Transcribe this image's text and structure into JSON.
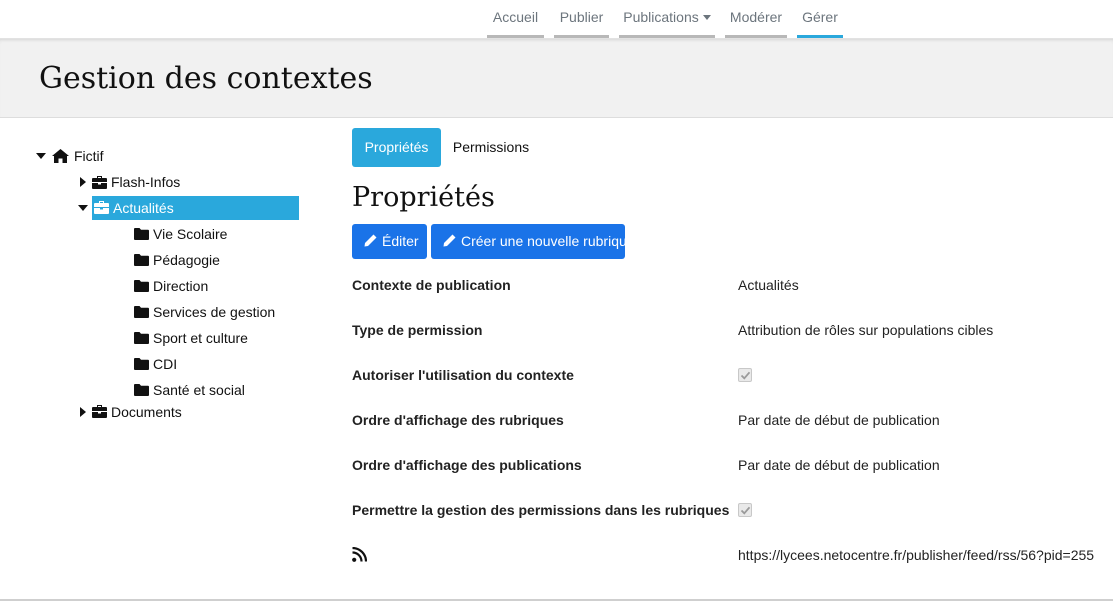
{
  "topnav": {
    "items": [
      {
        "label": "Accueil",
        "active": false
      },
      {
        "label": "Publier",
        "active": false
      },
      {
        "label": "Publications",
        "active": false,
        "dropdown": true
      },
      {
        "label": "Modérer",
        "active": false
      },
      {
        "label": "Gérer",
        "active": true
      }
    ]
  },
  "header": {
    "title": "Gestion des contextes"
  },
  "tree": {
    "root": {
      "label": "Fictif",
      "icon": "home-icon",
      "expanded": true
    },
    "items": [
      {
        "label": "Flash-Infos",
        "icon": "briefcase-icon",
        "expanded": false
      },
      {
        "label": "Actualités",
        "icon": "briefcase-icon",
        "expanded": true,
        "selected": true
      },
      {
        "label": "Vie Scolaire",
        "icon": "folder-icon"
      },
      {
        "label": "Pédagogie",
        "icon": "folder-icon"
      },
      {
        "label": "Direction",
        "icon": "folder-icon"
      },
      {
        "label": "Services de gestion",
        "icon": "folder-icon"
      },
      {
        "label": "Sport et culture",
        "icon": "folder-icon"
      },
      {
        "label": "CDI",
        "icon": "folder-icon"
      },
      {
        "label": "Santé et social",
        "icon": "folder-icon"
      },
      {
        "label": "Documents",
        "icon": "briefcase-icon",
        "expanded": false
      }
    ]
  },
  "tabs": [
    {
      "label": "Propriétés",
      "active": true
    },
    {
      "label": "Permissions",
      "active": false
    }
  ],
  "section": {
    "title": "Propriétés"
  },
  "actions": {
    "edit_label": "Éditer",
    "new_rubric_label": "Créer une nouvelle rubrique"
  },
  "properties": [
    {
      "label": "Contexte de publication",
      "value": "Actualités"
    },
    {
      "label": "Type de permission",
      "value": "Attribution de rôles sur populations cibles"
    },
    {
      "label": "Autoriser l'utilisation du contexte",
      "checked": true
    },
    {
      "label": "Ordre d'affichage des rubriques",
      "value": "Par date de début de publication"
    },
    {
      "label": "Ordre d'affichage des publications",
      "value": "Par date de début de publication"
    },
    {
      "label": "Permettre la gestion des permissions dans les rubriques",
      "checked": true
    },
    {
      "icon": "rss-icon",
      "value": "https://lycees.netocentre.fr/publisher/feed/rss/56?pid=255"
    }
  ],
  "colors": {
    "accent": "#2aa8dc",
    "button": "#1a73e8",
    "header_bg": "#f1f1f1"
  }
}
